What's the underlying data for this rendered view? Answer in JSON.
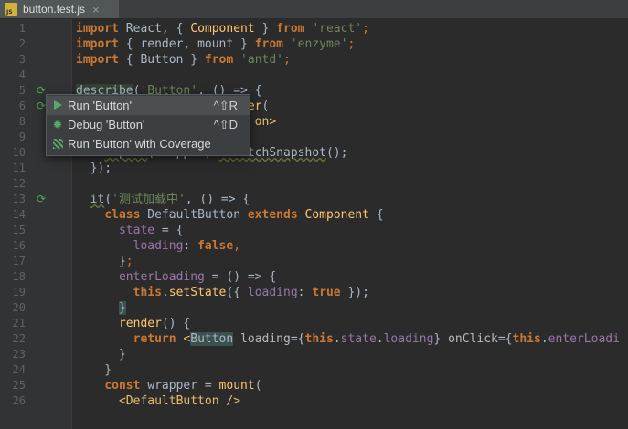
{
  "tab": {
    "filename": "button.test.js",
    "close": "×"
  },
  "lines": [
    {
      "n": "1",
      "tokens": [
        [
          "kw",
          "import"
        ],
        [
          "t",
          " React, { "
        ],
        [
          "cls",
          "Component"
        ],
        [
          "t",
          " } "
        ],
        [
          "kw",
          "from"
        ],
        [
          "t",
          " "
        ],
        [
          "str",
          "'react'"
        ],
        [
          "kwp",
          ";"
        ]
      ]
    },
    {
      "n": "2",
      "tokens": [
        [
          "kw",
          "import"
        ],
        [
          "t",
          " { "
        ],
        [
          "t",
          "render"
        ],
        [
          "t",
          ", "
        ],
        [
          "t",
          "mount"
        ],
        [
          "t",
          " } "
        ],
        [
          "kw",
          "from"
        ],
        [
          "t",
          " "
        ],
        [
          "str",
          "'enzyme'"
        ],
        [
          "kwp",
          ";"
        ]
      ]
    },
    {
      "n": "3",
      "tokens": [
        [
          "kw",
          "import"
        ],
        [
          "t",
          " { "
        ],
        [
          "t",
          "Button"
        ],
        [
          "t",
          " } "
        ],
        [
          "kw",
          "from"
        ],
        [
          "t",
          " "
        ],
        [
          "str",
          "'antd'"
        ],
        [
          "kwp",
          ";"
        ]
      ]
    },
    {
      "n": "4",
      "tokens": []
    },
    {
      "n": "5",
      "tokens": [
        [
          "hl",
          "describe"
        ],
        [
          "t",
          "("
        ],
        [
          "str",
          "'Button'"
        ],
        [
          "t",
          ", () => {"
        ]
      ]
    },
    {
      "n": "6",
      "tokens": [
        [
          "t",
          "                       "
        ],
        [
          "fn",
          "der"
        ],
        [
          "t",
          "("
        ]
      ]
    },
    {
      "n": "8",
      "tokens": [
        [
          "t",
          "                         "
        ],
        [
          "tag",
          "on>"
        ]
      ]
    },
    {
      "n": "9",
      "tokens": [
        [
          "t",
          "    );"
        ]
      ]
    },
    {
      "n": "10",
      "tokens": [
        [
          "t",
          "    "
        ],
        [
          "ul",
          "expect"
        ],
        [
          "t",
          "(wrapper)."
        ],
        [
          "ul",
          "toMatchSnapshot"
        ],
        [
          "t",
          "();"
        ]
      ]
    },
    {
      "n": "11",
      "tokens": [
        [
          "t",
          "  });"
        ]
      ]
    },
    {
      "n": "12",
      "tokens": []
    },
    {
      "n": "13",
      "tokens": [
        [
          "t",
          "  "
        ],
        [
          "ul",
          "it"
        ],
        [
          "t",
          "("
        ],
        [
          "str",
          "'测试加载中'"
        ],
        [
          "t",
          ", () => {"
        ]
      ]
    },
    {
      "n": "14",
      "tokens": [
        [
          "t",
          "    "
        ],
        [
          "kw",
          "class"
        ],
        [
          "t",
          " DefaultButton "
        ],
        [
          "kw",
          "extends"
        ],
        [
          "t",
          " "
        ],
        [
          "cls",
          "Component"
        ],
        [
          "t",
          " {"
        ]
      ]
    },
    {
      "n": "15",
      "tokens": [
        [
          "t",
          "      "
        ],
        [
          "prop",
          "state"
        ],
        [
          "t",
          " = {"
        ]
      ]
    },
    {
      "n": "16",
      "tokens": [
        [
          "t",
          "        "
        ],
        [
          "prop",
          "loading"
        ],
        [
          "t",
          ": "
        ],
        [
          "kw",
          "false"
        ],
        [
          "kwp",
          ","
        ]
      ]
    },
    {
      "n": "17",
      "tokens": [
        [
          "t",
          "      }"
        ],
        [
          "kwp",
          ";"
        ]
      ]
    },
    {
      "n": "18",
      "tokens": [
        [
          "t",
          "      "
        ],
        [
          "prop",
          "enterLoading"
        ],
        [
          "t",
          " = () => {"
        ]
      ]
    },
    {
      "n": "19",
      "tokens": [
        [
          "t",
          "        "
        ],
        [
          "kw",
          "this"
        ],
        [
          "t",
          "."
        ],
        [
          "fn",
          "setState"
        ],
        [
          "t",
          "({ "
        ],
        [
          "prop",
          "loading"
        ],
        [
          "t",
          ": "
        ],
        [
          "kw",
          "true"
        ],
        [
          "t",
          " });"
        ]
      ]
    },
    {
      "n": "20",
      "tokens": [
        [
          "t",
          "      "
        ],
        [
          "match",
          "}"
        ]
      ]
    },
    {
      "n": "21",
      "tokens": [
        [
          "t",
          "      "
        ],
        [
          "fn",
          "render"
        ],
        [
          "t",
          "() {"
        ]
      ]
    },
    {
      "n": "22",
      "tokens": [
        [
          "t",
          "        "
        ],
        [
          "kw",
          "return"
        ],
        [
          "t",
          " "
        ],
        [
          "tag",
          "<"
        ],
        [
          "match",
          "Button"
        ],
        [
          "t",
          " "
        ],
        [
          "attr",
          "loading"
        ],
        [
          "t",
          "={"
        ],
        [
          "kw",
          "this"
        ],
        [
          "t",
          "."
        ],
        [
          "prop",
          "state"
        ],
        [
          "t",
          "."
        ],
        [
          "prop",
          "loading"
        ],
        [
          "t",
          "} "
        ],
        [
          "attr",
          "onClick"
        ],
        [
          "t",
          "={"
        ],
        [
          "kw",
          "this"
        ],
        [
          "t",
          "."
        ],
        [
          "prop",
          "enterLoadi"
        ]
      ]
    },
    {
      "n": "23",
      "tokens": [
        [
          "t",
          "      }"
        ]
      ]
    },
    {
      "n": "24",
      "tokens": [
        [
          "t",
          "    }"
        ]
      ]
    },
    {
      "n": "25",
      "tokens": [
        [
          "t",
          "    "
        ],
        [
          "kw",
          "const"
        ],
        [
          "t",
          " wrapper = "
        ],
        [
          "fn",
          "mount"
        ],
        [
          "t",
          "("
        ]
      ]
    },
    {
      "n": "26",
      "tokens": [
        [
          "t",
          "      "
        ],
        [
          "tag",
          "<DefaultButton />"
        ]
      ]
    }
  ],
  "gutter_icons": {
    "5": "run-icon",
    "6": "run-icon",
    "13": "run-icon"
  },
  "popup": {
    "items": [
      {
        "label": "Run 'Button'",
        "shortcut": "^⇧R",
        "icon": "run-icon"
      },
      {
        "label": "Debug 'Button'",
        "shortcut": "^⇧D",
        "icon": "debug-icon"
      },
      {
        "label": "Run 'Button' with Coverage",
        "shortcut": "",
        "icon": "coverage-icon"
      }
    ]
  },
  "colors": {
    "background": "#2b2b2b",
    "keyword": "#cc7832",
    "string": "#6a8759",
    "function": "#ffc66d",
    "property": "#9876aa",
    "run_green": "#59a869"
  }
}
